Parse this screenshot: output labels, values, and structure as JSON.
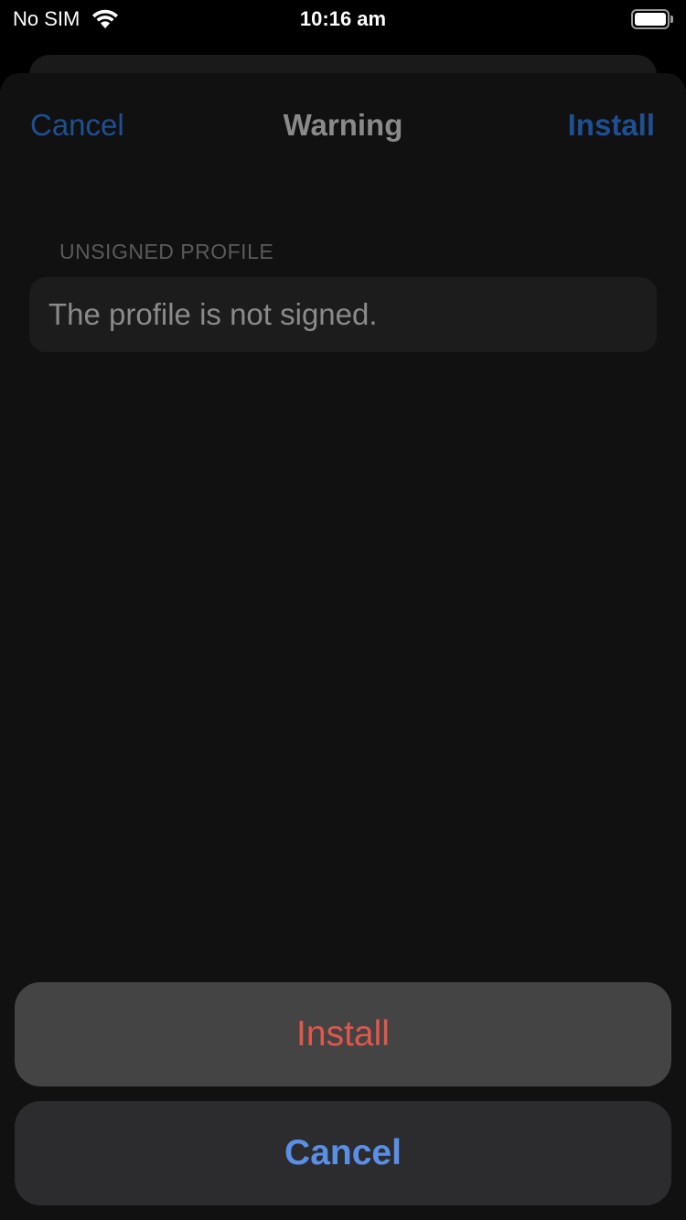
{
  "status_bar": {
    "carrier": "No SIM",
    "time": "10:16 am",
    "wifi_icon": "wifi-icon",
    "battery_icon": "battery-full-icon"
  },
  "nav": {
    "cancel_label": "Cancel",
    "title": "Warning",
    "install_label": "Install"
  },
  "section": {
    "header": "UNSIGNED PROFILE",
    "text": "The profile is not signed."
  },
  "action_sheet": {
    "install_label": "Install",
    "cancel_label": "Cancel"
  },
  "colors": {
    "link_blue": "#1e4f92",
    "destructive_red": "#e2574b",
    "cancel_blue": "#5a8fe6"
  }
}
